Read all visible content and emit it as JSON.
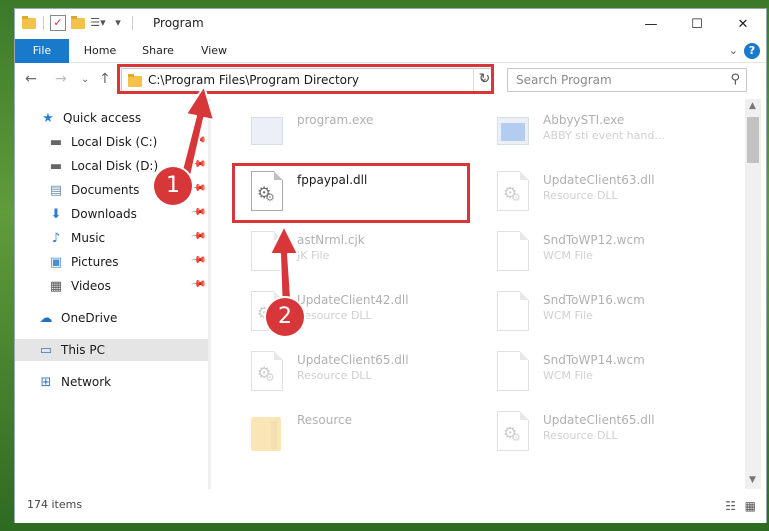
{
  "window": {
    "title": "Program",
    "controls": {
      "minimize": "—",
      "maximize": "☐",
      "close": "✕"
    }
  },
  "ribbon": {
    "tabs": [
      "File",
      "Home",
      "Share",
      "View"
    ],
    "help": "?"
  },
  "navigation": {
    "address": "C:\\Program Files\\Program Directory",
    "search_placeholder": "Search Program"
  },
  "sidebar": {
    "items": [
      {
        "label": "Quick access",
        "icon": "star-icon",
        "pinned": false
      },
      {
        "label": "Local Disk (C:)",
        "icon": "drive-icon",
        "pinned": true
      },
      {
        "label": "Local Disk (D:)",
        "icon": "drive-icon",
        "pinned": true
      },
      {
        "label": "Documents",
        "icon": "documents-icon",
        "pinned": true
      },
      {
        "label": "Downloads",
        "icon": "download-arrow-icon",
        "pinned": true
      },
      {
        "label": "Music",
        "icon": "music-note-icon",
        "pinned": true
      },
      {
        "label": "Pictures",
        "icon": "pictures-icon",
        "pinned": true
      },
      {
        "label": "Videos",
        "icon": "film-icon",
        "pinned": true
      },
      {
        "label": "OneDrive",
        "icon": "cloud-icon",
        "pinned": false
      },
      {
        "label": "This PC",
        "icon": "monitor-icon",
        "pinned": false
      },
      {
        "label": "Network",
        "icon": "network-icon",
        "pinned": false
      }
    ]
  },
  "files": [
    {
      "name": "program.exe",
      "type": "",
      "icon": "exe-icon",
      "faded": true
    },
    {
      "name": "AbbyySTI.exe",
      "type": "ABBY sti event hand...",
      "icon": "exe-blue-icon",
      "faded": true
    },
    {
      "name": "fppaypal.dll",
      "type": "",
      "icon": "dll-gear-icon",
      "faded": false
    },
    {
      "name": "UpdateClient63.dll",
      "type": "Resource DLL",
      "icon": "dll-gear-icon",
      "faded": true
    },
    {
      "name": "astNrml.cjk",
      "type": "JK File",
      "icon": "blank-file-icon",
      "faded": true
    },
    {
      "name": "SndToWP12.wcm",
      "type": "WCM File",
      "icon": "blank-file-icon",
      "faded": true
    },
    {
      "name": "UpdateClient42.dll",
      "type": "Resource DLL",
      "icon": "dll-gear-icon",
      "faded": true
    },
    {
      "name": "SndToWP16.wcm",
      "type": "WCM File",
      "icon": "blank-file-icon",
      "faded": true
    },
    {
      "name": "UpdateClient65.dll",
      "type": "Resource DLL",
      "icon": "dll-gear-icon",
      "faded": true
    },
    {
      "name": "SndToWP14.wcm",
      "type": "WCM File",
      "icon": "blank-file-icon",
      "faded": true
    },
    {
      "name": "Resource",
      "type": "",
      "icon": "folder-icon",
      "faded": true
    },
    {
      "name": "UpdateClient65.dll",
      "type": "Resource DLL",
      "icon": "dll-gear-icon",
      "faded": true
    }
  ],
  "status": {
    "item_count": "174 items"
  },
  "callouts": {
    "step1": "1",
    "step2": "2",
    "color": "#d8373a"
  }
}
